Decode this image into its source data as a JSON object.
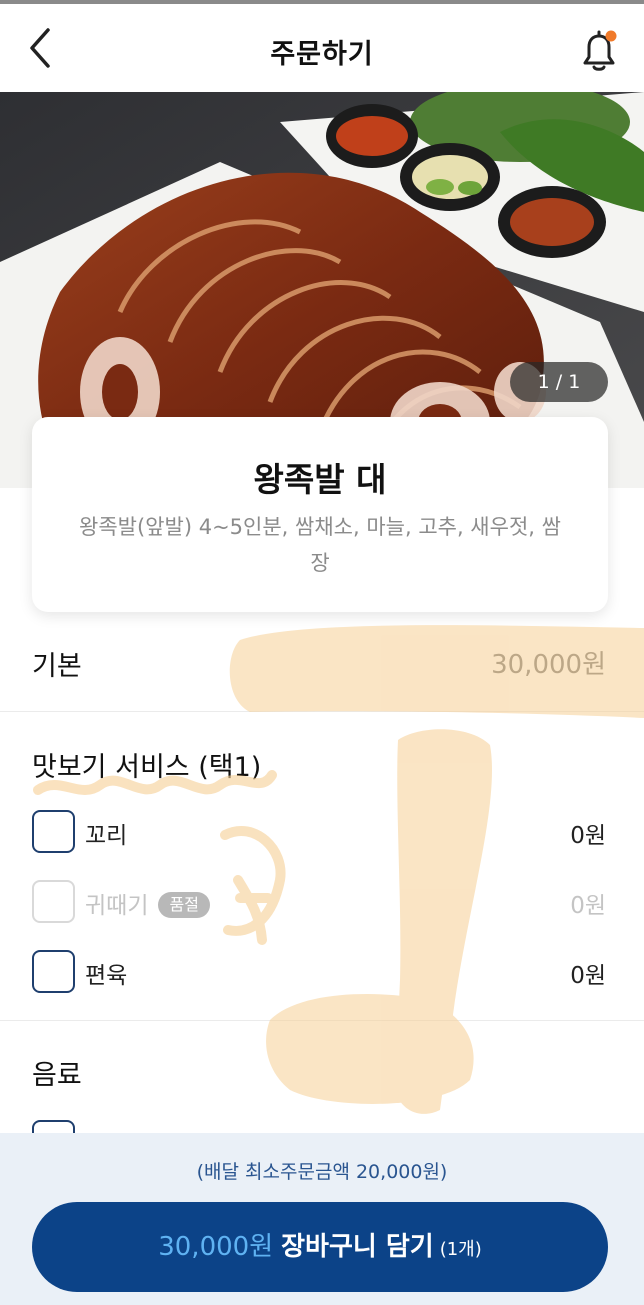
{
  "header": {
    "title": "주문하기",
    "back_icon": "chevron-left-icon",
    "bell_icon": "bell-icon",
    "notification_dot_color": "#f07a2a"
  },
  "hero": {
    "counter": "1 / 1"
  },
  "product": {
    "name": "왕족발 대",
    "description": "왕족발(앞발) 4~5인분, 쌈채소, 마늘, 고추, 새우젓, 쌈장"
  },
  "base": {
    "label": "기본",
    "price": "30,000원"
  },
  "tasting": {
    "title": "맛보기 서비스 (택1)",
    "options": [
      {
        "name": "꼬리",
        "price": "0원",
        "available": true
      },
      {
        "name": "귀때기",
        "price": "0원",
        "available": false,
        "badge": "품절"
      },
      {
        "name": "편육",
        "price": "0원",
        "available": true
      }
    ]
  },
  "drinks": {
    "title": "음료"
  },
  "footer": {
    "min_order": "(배달 최소주문금액 20,000원)",
    "cart_price": "30,000원",
    "cart_label": "장바구니 담기",
    "cart_count": "(1개)"
  },
  "colors": {
    "primary": "#0c4388",
    "primary_light": "#5fb2f2",
    "footer_bg": "#eaf0f7",
    "checkbox_border": "#1f3f6e",
    "scribble": "#f6cf95"
  }
}
